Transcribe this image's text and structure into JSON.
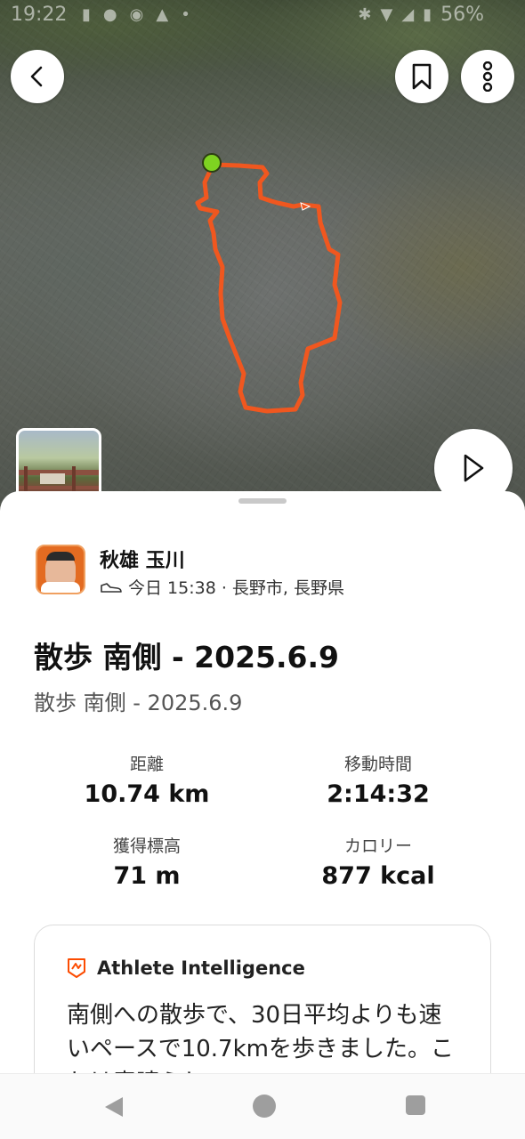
{
  "status_bar": {
    "time": "19:22",
    "battery": "56%",
    "icons": [
      "notification-icon",
      "person-icon",
      "messenger-icon",
      "warning-icon",
      "dot-icon",
      "bluetooth-icon",
      "wifi-icon",
      "signal-icon",
      "battery-icon"
    ]
  },
  "map": {
    "route_color": "#f0571f",
    "start_marker_color": "#7ed321"
  },
  "athlete": {
    "name": "秋雄 玉川",
    "activity_icon": "shoe-icon",
    "meta": "今日 15:38 · 長野市, 長野県"
  },
  "activity": {
    "title": "散歩 南側 - 2025.6.9",
    "subtitle": "散歩 南側 - 2025.6.9"
  },
  "stats": [
    {
      "label": "距離",
      "value": "10.74 km"
    },
    {
      "label": "移動時間",
      "value": "2:14:32"
    },
    {
      "label": "獲得標高",
      "value": "71 m"
    },
    {
      "label": "カロリー",
      "value": "877 kcal"
    }
  ],
  "athlete_intelligence": {
    "title": "Athlete Intelligence",
    "text": "南側への散歩で、30日平均よりも速いペースで10.7kmを歩きました。これは素晴らしい"
  },
  "colors": {
    "accent": "#fc4c02",
    "route": "#f0571f"
  }
}
